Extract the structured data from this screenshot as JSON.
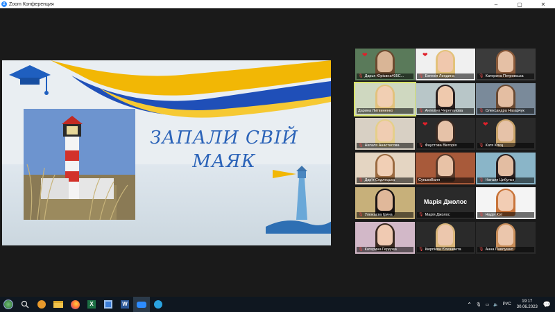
{
  "window": {
    "title": "Zoom Конференция",
    "controls": [
      "–",
      "▢",
      "✕"
    ]
  },
  "slide": {
    "title_line1": "ЗАПАЛИ СВІЙ",
    "title_line2": "МАЯК"
  },
  "participants": [
    {
      "name": "Дарья Юрієвна405С...",
      "heart": true,
      "mic_muted": true
    },
    {
      "name": "Евгенія Линдина",
      "heart": true,
      "mic_muted": true
    },
    {
      "name": "Катерина Петровська",
      "heart": false,
      "mic_muted": true
    },
    {
      "name": "Дарина Литвиненко",
      "heart": false,
      "mic_muted": false,
      "active": true
    },
    {
      "name": "Ангеліна Черепанова",
      "heart": false,
      "mic_muted": true
    },
    {
      "name": "Олександра Назарчук",
      "heart": false,
      "mic_muted": true
    },
    {
      "name": "Наталя Анастасова",
      "heart": false,
      "mic_muted": true
    },
    {
      "name": "Фаустова Вікторія",
      "heart": true,
      "mic_muted": true
    },
    {
      "name": "Катя Клєц",
      "heart": true,
      "mic_muted": true
    },
    {
      "name": "Дар'я Седлецька",
      "heart": false,
      "mic_muted": true
    },
    {
      "name": "СунькоВаля",
      "heart": false,
      "mic_muted": false
    },
    {
      "name": "Наталя Цибулєк",
      "heart": false,
      "mic_muted": true
    },
    {
      "name": "Улюкаєва Ірина",
      "heart": false,
      "mic_muted": true
    },
    {
      "name": "Марія Джолос",
      "heart": false,
      "mic_muted": true,
      "no_video": true,
      "display": "Марія Джолос"
    },
    {
      "name": "Надія Кот",
      "heart": false,
      "mic_muted": true
    },
    {
      "name": "Катерина Гердова",
      "heart": false,
      "mic_muted": true
    },
    {
      "name": "Кюрпієва Єлизавета",
      "heart": false,
      "mic_muted": true
    },
    {
      "name": "Анна Павлушко",
      "heart": false,
      "mic_muted": true
    }
  ],
  "taskbar": {
    "language": "РУС",
    "time": "19:17",
    "date": "30.06.2023",
    "apps": [
      "start",
      "search",
      "app-lion",
      "explorer",
      "firefox",
      "excel",
      "save-app",
      "word",
      "zoom",
      "telegram"
    ]
  },
  "colors": {
    "slide_title": "#2b63b8",
    "accent_yellow": "#f2b705",
    "accent_blue": "#1f4fb8",
    "active_border": "#d8e36a"
  }
}
